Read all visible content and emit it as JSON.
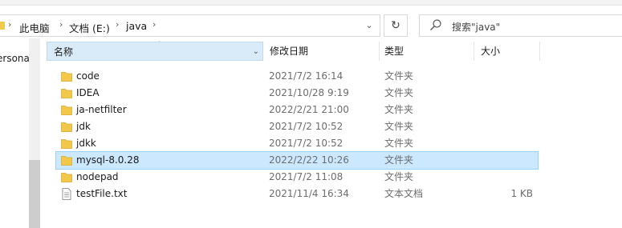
{
  "breadcrumb": {
    "items": [
      "此电脑",
      "文档 (E:)",
      "java"
    ]
  },
  "search": {
    "placeholder": "搜索\"java\""
  },
  "nav": {
    "partial_item": "ersona"
  },
  "columns": {
    "name": "名称",
    "date": "修改日期",
    "type": "类型",
    "size": "大小"
  },
  "files": [
    {
      "name": "code",
      "date": "2021/7/2 16:14",
      "type": "文件夹",
      "size": "",
      "icon": "folder-icon"
    },
    {
      "name": "IDEA",
      "date": "2021/10/28 9:19",
      "type": "文件夹",
      "size": "",
      "icon": "folder-icon"
    },
    {
      "name": "ja-netfilter",
      "date": "2022/2/21 21:00",
      "type": "文件夹",
      "size": "",
      "icon": "folder-icon"
    },
    {
      "name": "jdk",
      "date": "2021/7/2 10:52",
      "type": "文件夹",
      "size": "",
      "icon": "folder-icon"
    },
    {
      "name": "jdkk",
      "date": "2021/7/2 10:52",
      "type": "文件夹",
      "size": "",
      "icon": "folder-icon"
    },
    {
      "name": "mysql-8.0.28",
      "date": "2022/2/22 10:26",
      "type": "文件夹",
      "size": "",
      "icon": "folder-icon",
      "selected": true
    },
    {
      "name": "nodepad",
      "date": "2021/7/2 11:08",
      "type": "文件夹",
      "size": "",
      "icon": "folder-icon"
    },
    {
      "name": "testFile.txt",
      "date": "2021/11/4 16:34",
      "type": "文本文档",
      "size": "1 KB",
      "icon": "text-file-icon"
    }
  ],
  "colors": {
    "selection": "#cce8ff",
    "selection_border": "#99d1ff",
    "folder": "#f2c84b",
    "sorted_header": "#d9ebf9"
  }
}
